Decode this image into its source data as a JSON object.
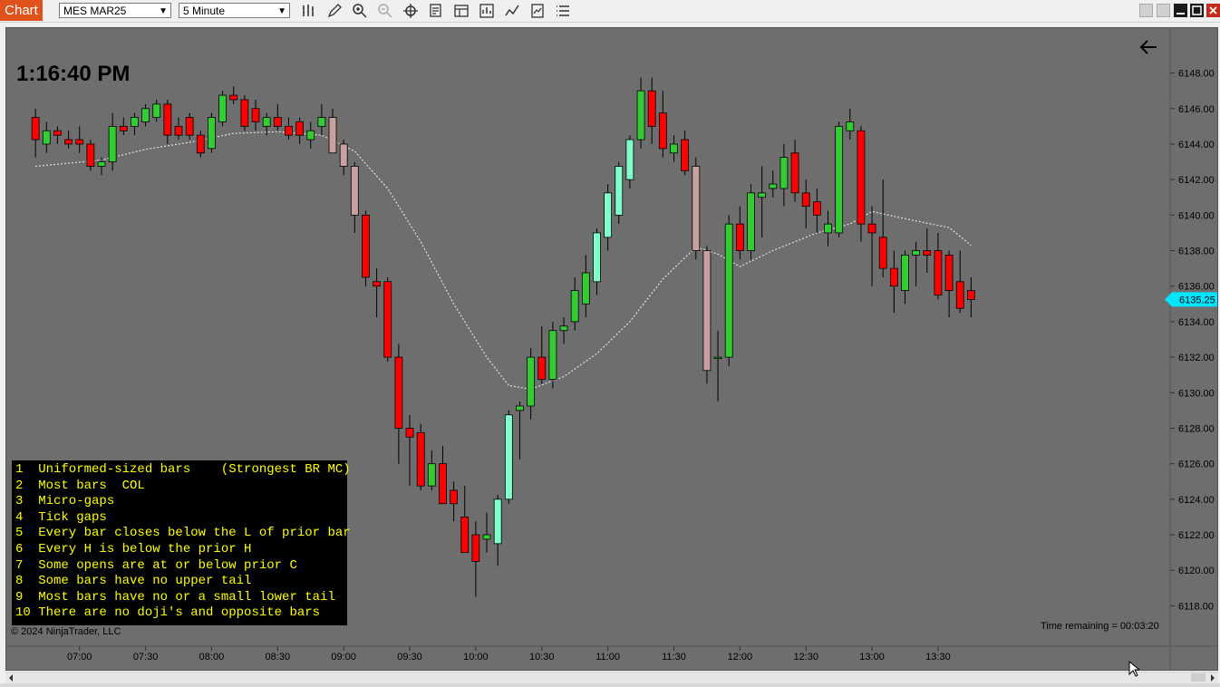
{
  "window": {
    "tab_label": "Chart",
    "instrument": "MES MAR25",
    "interval": "5 Minute",
    "toolbar_icons": [
      "bars-icon",
      "pencil-icon",
      "zoom-in-icon",
      "zoom-out-icon",
      "crosshair-icon",
      "data-box-icon",
      "properties-icon",
      "strategy-icon",
      "indicator-icon",
      "template-icon",
      "list-icon"
    ],
    "window_buttons": [
      "tile-icon",
      "tile-icon",
      "minimize-icon",
      "maximize-icon",
      "close-icon"
    ]
  },
  "chart": {
    "current_time": "1:16:40 PM",
    "time_remaining": "Time remaining = 00:03:20",
    "copyright": "© 2024 NinjaTrader, LLC",
    "last_price_label": "6135.25",
    "colors": {
      "background": "#6e6e6e",
      "up": "#33cc33",
      "down": "#ff0000",
      "up_light": "#80ffcc",
      "down_light": "#c8a0a0",
      "ma": "#e0e0e0",
      "price_marker": "#00e5ff",
      "notes_text": "#ffff00"
    }
  },
  "notes": [
    "1  Uniformed-sized bars    (Strongest BR MC)",
    "2  Most bars  COL",
    "3  Micro-gaps",
    "4  Tick gaps",
    "5  Every bar closes below the L of prior bar",
    "6  Every H is below the prior H",
    "7  Some opens are at or below prior C",
    "8  Some bars have no upper tail",
    "9  Most bars have no or a small lower tail",
    "10 There are no doji's and opposite bars"
  ],
  "chart_data": {
    "type": "candlestick",
    "bar_interval_minutes": 5,
    "ylim": [
      6117,
      6149
    ],
    "y_ticks": [
      "6118.00",
      "6120.00",
      "6122.00",
      "6124.00",
      "6126.00",
      "6128.00",
      "6130.00",
      "6132.00",
      "6134.00",
      "6136.00",
      "6138.00",
      "6140.00",
      "6142.00",
      "6144.00",
      "6146.00",
      "6148.00"
    ],
    "x_ticks": [
      "07:00",
      "07:30",
      "08:00",
      "08:30",
      "09:00",
      "09:30",
      "10:00",
      "10:30",
      "11:00",
      "11:30",
      "12:00",
      "12:30",
      "13:00",
      "13:30"
    ],
    "x_range": [
      "06:35",
      "13:35"
    ],
    "bars": [
      {
        "t": "06:40",
        "o": 6145.5,
        "h": 6146,
        "l": 6143.25,
        "c": 6144.25
      },
      {
        "t": "06:45",
        "o": 6144,
        "h": 6145.25,
        "l": 6143.5,
        "c": 6144.75
      },
      {
        "t": "06:50",
        "o": 6144.75,
        "h": 6145,
        "l": 6144,
        "c": 6144.5
      },
      {
        "t": "06:55",
        "o": 6144.25,
        "h": 6144.75,
        "l": 6143.75,
        "c": 6144
      },
      {
        "t": "07:00",
        "o": 6144.25,
        "h": 6145,
        "l": 6143.5,
        "c": 6144
      },
      {
        "t": "07:05",
        "o": 6144,
        "h": 6144.25,
        "l": 6142.5,
        "c": 6142.75
      },
      {
        "t": "07:10",
        "o": 6142.75,
        "h": 6143.25,
        "l": 6142.25,
        "c": 6143
      },
      {
        "t": "07:15",
        "o": 6143,
        "h": 6145.75,
        "l": 6142.5,
        "c": 6145
      },
      {
        "t": "07:20",
        "o": 6145,
        "h": 6145.5,
        "l": 6144.5,
        "c": 6144.75
      },
      {
        "t": "07:25",
        "o": 6145,
        "h": 6145.75,
        "l": 6144.5,
        "c": 6145.5
      },
      {
        "t": "07:30",
        "o": 6145.25,
        "h": 6146.25,
        "l": 6145,
        "c": 6146
      },
      {
        "t": "07:35",
        "o": 6145.5,
        "h": 6146.5,
        "l": 6145.25,
        "c": 6146.25
      },
      {
        "t": "07:40",
        "o": 6146.25,
        "h": 6146.5,
        "l": 6144,
        "c": 6144.5
      },
      {
        "t": "07:45",
        "o": 6145,
        "h": 6145.5,
        "l": 6144.25,
        "c": 6144.5
      },
      {
        "t": "07:50",
        "o": 6145.5,
        "h": 6145.75,
        "l": 6144.25,
        "c": 6144.5
      },
      {
        "t": "07:55",
        "o": 6144.5,
        "h": 6144.75,
        "l": 6143.25,
        "c": 6143.5
      },
      {
        "t": "08:00",
        "o": 6143.75,
        "h": 6145.75,
        "l": 6143.5,
        "c": 6145.5
      },
      {
        "t": "08:05",
        "o": 6145.25,
        "h": 6147,
        "l": 6145,
        "c": 6146.75
      },
      {
        "t": "08:10",
        "o": 6146.75,
        "h": 6147.25,
        "l": 6146.25,
        "c": 6146.5
      },
      {
        "t": "08:15",
        "o": 6146.5,
        "h": 6146.75,
        "l": 6144.75,
        "c": 6145
      },
      {
        "t": "08:20",
        "o": 6146,
        "h": 6146.5,
        "l": 6144.75,
        "c": 6145.25
      },
      {
        "t": "08:25",
        "o": 6145,
        "h": 6145.75,
        "l": 6144.5,
        "c": 6145.5
      },
      {
        "t": "08:30",
        "o": 6145.5,
        "h": 6146.25,
        "l": 6144.75,
        "c": 6145
      },
      {
        "t": "08:35",
        "o": 6145,
        "h": 6145.5,
        "l": 6144.25,
        "c": 6144.5
      },
      {
        "t": "08:40",
        "o": 6145.25,
        "h": 6145.5,
        "l": 6144,
        "c": 6144.5
      },
      {
        "t": "08:45",
        "o": 6144.25,
        "h": 6145.25,
        "l": 6143.75,
        "c": 6144.75
      },
      {
        "t": "08:50",
        "o": 6145,
        "h": 6146.25,
        "l": 6144.5,
        "c": 6145.5
      },
      {
        "t": "08:55",
        "o": 6145.5,
        "h": 6146,
        "l": 6143.5,
        "c": 6143.5
      },
      {
        "t": "09:00",
        "o": 6144,
        "h": 6144.25,
        "l": 6142.25,
        "c": 6142.75
      },
      {
        "t": "09:05",
        "o": 6142.75,
        "h": 6143,
        "l": 6139,
        "c": 6140
      },
      {
        "t": "09:10",
        "o": 6140,
        "h": 6140.25,
        "l": 6136,
        "c": 6136.5
      },
      {
        "t": "09:15",
        "o": 6136.25,
        "h": 6137,
        "l": 6134.25,
        "c": 6136
      },
      {
        "t": "09:20",
        "o": 6136.25,
        "h": 6136.5,
        "l": 6131.75,
        "c": 6132
      },
      {
        "t": "09:25",
        "o": 6132,
        "h": 6132.75,
        "l": 6126,
        "c": 6128
      },
      {
        "t": "09:30",
        "o": 6128,
        "h": 6128.75,
        "l": 6124.75,
        "c": 6127.5
      },
      {
        "t": "09:35",
        "o": 6127.75,
        "h": 6128.25,
        "l": 6124.5,
        "c": 6124.75
      },
      {
        "t": "09:40",
        "o": 6124.75,
        "h": 6126.75,
        "l": 6124.5,
        "c": 6126
      },
      {
        "t": "09:45",
        "o": 6126,
        "h": 6127,
        "l": 6123.75,
        "c": 6123.75
      },
      {
        "t": "09:50",
        "o": 6124.5,
        "h": 6125,
        "l": 6122.75,
        "c": 6123.75
      },
      {
        "t": "09:55",
        "o": 6123,
        "h": 6124.75,
        "l": 6121.5,
        "c": 6121
      },
      {
        "t": "10:00",
        "o": 6122,
        "h": 6122.75,
        "l": 6118.5,
        "c": 6120.5
      },
      {
        "t": "10:05",
        "o": 6121.75,
        "h": 6123.25,
        "l": 6121,
        "c": 6122
      },
      {
        "t": "10:10",
        "o": 6121.5,
        "h": 6124.25,
        "l": 6120.25,
        "c": 6124
      },
      {
        "t": "10:15",
        "o": 6124,
        "h": 6129,
        "l": 6123.75,
        "c": 6128.75
      },
      {
        "t": "10:20",
        "o": 6129,
        "h": 6129.5,
        "l": 6126.25,
        "c": 6129.25
      },
      {
        "t": "10:25",
        "o": 6129.25,
        "h": 6132.5,
        "l": 6128.5,
        "c": 6132
      },
      {
        "t": "10:30",
        "o": 6132,
        "h": 6133.75,
        "l": 6130.5,
        "c": 6130.75
      },
      {
        "t": "10:35",
        "o": 6130.75,
        "h": 6134,
        "l": 6130.25,
        "c": 6133.5
      },
      {
        "t": "10:40",
        "o": 6133.5,
        "h": 6134.25,
        "l": 6132.75,
        "c": 6133.75
      },
      {
        "t": "10:45",
        "o": 6134,
        "h": 6136.5,
        "l": 6133.5,
        "c": 6135.75
      },
      {
        "t": "10:50",
        "o": 6135,
        "h": 6137.75,
        "l": 6134.25,
        "c": 6136.75
      },
      {
        "t": "10:55",
        "o": 6136.25,
        "h": 6139.25,
        "l": 6135.5,
        "c": 6139
      },
      {
        "t": "11:00",
        "o": 6138.75,
        "h": 6141.75,
        "l": 6138,
        "c": 6141.25
      },
      {
        "t": "11:05",
        "o": 6140,
        "h": 6143,
        "l": 6139.5,
        "c": 6142.75
      },
      {
        "t": "11:10",
        "o": 6142,
        "h": 6144.5,
        "l": 6141.5,
        "c": 6144.25
      },
      {
        "t": "11:15",
        "o": 6144.25,
        "h": 6147.75,
        "l": 6143.75,
        "c": 6147
      },
      {
        "t": "11:20",
        "o": 6147,
        "h": 6147.75,
        "l": 6144,
        "c": 6145
      },
      {
        "t": "11:25",
        "o": 6145.75,
        "h": 6147,
        "l": 6143.25,
        "c": 6143.75
      },
      {
        "t": "11:30",
        "o": 6143.5,
        "h": 6144.5,
        "l": 6143,
        "c": 6144
      },
      {
        "t": "11:35",
        "o": 6144.25,
        "h": 6144.75,
        "l": 6142.25,
        "c": 6142.5
      },
      {
        "t": "11:40",
        "o": 6142.75,
        "h": 6143.25,
        "l": 6137.5,
        "c": 6138
      },
      {
        "t": "11:45",
        "o": 6138,
        "h": 6138.25,
        "l": 6130.5,
        "c": 6131.25
      },
      {
        "t": "11:50",
        "o": 6132,
        "h": 6133.5,
        "l": 6129.5,
        "c": 6132
      },
      {
        "t": "11:55",
        "o": 6132,
        "h": 6140,
        "l": 6131.5,
        "c": 6139.5
      },
      {
        "t": "12:00",
        "o": 6139.5,
        "h": 6140.5,
        "l": 6137.5,
        "c": 6138
      },
      {
        "t": "12:05",
        "o": 6138,
        "h": 6141.75,
        "l": 6137.5,
        "c": 6141.25
      },
      {
        "t": "12:10",
        "o": 6141,
        "h": 6142.75,
        "l": 6138.75,
        "c": 6141.25
      },
      {
        "t": "12:15",
        "o": 6141.5,
        "h": 6142.5,
        "l": 6141,
        "c": 6141.75
      },
      {
        "t": "12:20",
        "o": 6141.5,
        "h": 6144,
        "l": 6140.5,
        "c": 6143.25
      },
      {
        "t": "12:25",
        "o": 6143.5,
        "h": 6144.25,
        "l": 6140.75,
        "c": 6141.25
      },
      {
        "t": "12:30",
        "o": 6141.25,
        "h": 6142,
        "l": 6139.25,
        "c": 6140.5
      },
      {
        "t": "12:35",
        "o": 6140.75,
        "h": 6141.5,
        "l": 6139,
        "c": 6140
      },
      {
        "t": "12:40",
        "o": 6139,
        "h": 6140.25,
        "l": 6138.25,
        "c": 6139.5
      },
      {
        "t": "12:45",
        "o": 6139,
        "h": 6145.25,
        "l": 6138.75,
        "c": 6145
      },
      {
        "t": "12:50",
        "o": 6144.75,
        "h": 6146,
        "l": 6144.25,
        "c": 6145.25
      },
      {
        "t": "12:55",
        "o": 6144.75,
        "h": 6145,
        "l": 6138.5,
        "c": 6139.5
      },
      {
        "t": "13:00",
        "o": 6139.5,
        "h": 6140.5,
        "l": 6136,
        "c": 6139
      },
      {
        "t": "13:05",
        "o": 6138.75,
        "h": 6142,
        "l": 6136.5,
        "c": 6137
      },
      {
        "t": "13:10",
        "o": 6137,
        "h": 6138,
        "l": 6134.5,
        "c": 6136
      },
      {
        "t": "13:15",
        "o": 6135.75,
        "h": 6138,
        "l": 6135,
        "c": 6137.75
      },
      {
        "t": "13:20",
        "o": 6137.75,
        "h": 6138.5,
        "l": 6136,
        "c": 6138
      },
      {
        "t": "13:25",
        "o": 6138,
        "h": 6139.25,
        "l": 6136.75,
        "c": 6137.75
      },
      {
        "t": "13:30",
        "o": 6138,
        "h": 6139,
        "l": 6135.25,
        "c": 6135.5
      },
      {
        "t": "13:35",
        "o": 6137.75,
        "h": 6138,
        "l": 6134.25,
        "c": 6135.75
      },
      {
        "t": "13:40",
        "o": 6136.25,
        "h": 6138,
        "l": 6134.5,
        "c": 6134.75
      },
      {
        "t": "13:45",
        "o": 6135.75,
        "h": 6136.5,
        "l": 6134.25,
        "c": 6135.25
      }
    ],
    "moving_average": [
      {
        "t": "06:40",
        "v": 6142.75
      },
      {
        "t": "07:10",
        "v": 6143.1
      },
      {
        "t": "07:30",
        "v": 6143.7
      },
      {
        "t": "07:50",
        "v": 6144.1
      },
      {
        "t": "08:10",
        "v": 6144.6
      },
      {
        "t": "08:30",
        "v": 6144.7
      },
      {
        "t": "08:50",
        "v": 6144.5
      },
      {
        "t": "09:05",
        "v": 6143.6
      },
      {
        "t": "09:20",
        "v": 6141.5
      },
      {
        "t": "09:35",
        "v": 6138.5
      },
      {
        "t": "09:50",
        "v": 6135
      },
      {
        "t": "10:05",
        "v": 6132
      },
      {
        "t": "10:15",
        "v": 6130.4
      },
      {
        "t": "10:25",
        "v": 6130.2
      },
      {
        "t": "10:40",
        "v": 6130.9
      },
      {
        "t": "10:55",
        "v": 6132.2
      },
      {
        "t": "11:10",
        "v": 6134
      },
      {
        "t": "11:25",
        "v": 6136.4
      },
      {
        "t": "11:40",
        "v": 6138.2
      },
      {
        "t": "11:50",
        "v": 6137.8
      },
      {
        "t": "12:00",
        "v": 6137.1
      },
      {
        "t": "12:15",
        "v": 6138
      },
      {
        "t": "12:35",
        "v": 6139
      },
      {
        "t": "12:50",
        "v": 6139.5
      },
      {
        "t": "13:00",
        "v": 6140.2
      },
      {
        "t": "13:15",
        "v": 6139.8
      },
      {
        "t": "13:35",
        "v": 6139.3
      },
      {
        "t": "13:45",
        "v": 6138.3
      }
    ]
  }
}
